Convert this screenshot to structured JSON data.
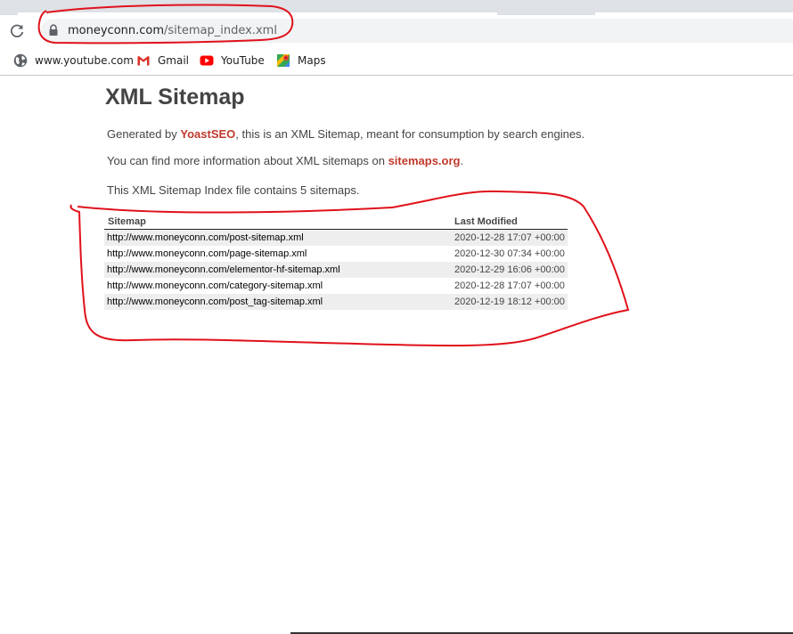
{
  "browser": {
    "address_bar": {
      "host": "moneyconn.com",
      "path": "/sitemap_index.xml"
    },
    "bookmarks": [
      {
        "label": "www.youtube.com",
        "icon": "globe-icon"
      },
      {
        "label": "Gmail",
        "icon": "gmail-icon"
      },
      {
        "label": "YouTube",
        "icon": "youtube-icon"
      },
      {
        "label": "Maps",
        "icon": "maps-icon"
      }
    ]
  },
  "page": {
    "title": "XML Sitemap",
    "intro": {
      "prefix": "Generated by ",
      "link_text": "YoastSEO",
      "suffix": ", this is an XML Sitemap, meant for consumption by search engines."
    },
    "info": {
      "prefix": "You can find more information about XML sitemaps on ",
      "link_text": "sitemaps.org",
      "suffix": "."
    },
    "summary": "This XML Sitemap Index file contains 5 sitemaps.",
    "table": {
      "headers": {
        "sitemap": "Sitemap",
        "last_modified": "Last Modified"
      },
      "rows": [
        {
          "url": "http://www.moneyconn.com/post-sitemap.xml",
          "last_modified": "2020-12-28 17:07 +00:00"
        },
        {
          "url": "http://www.moneyconn.com/page-sitemap.xml",
          "last_modified": "2020-12-30 07:34 +00:00"
        },
        {
          "url": "http://www.moneyconn.com/elementor-hf-sitemap.xml",
          "last_modified": "2020-12-29 16:06 +00:00"
        },
        {
          "url": "http://www.moneyconn.com/category-sitemap.xml",
          "last_modified": "2020-12-28 17:07 +00:00"
        },
        {
          "url": "http://www.moneyconn.com/post_tag-sitemap.xml",
          "last_modified": "2020-12-19 18:12 +00:00"
        }
      ]
    }
  },
  "colors": {
    "link": "#c0392b",
    "annotation": "#e0111b",
    "text": "#444444"
  }
}
